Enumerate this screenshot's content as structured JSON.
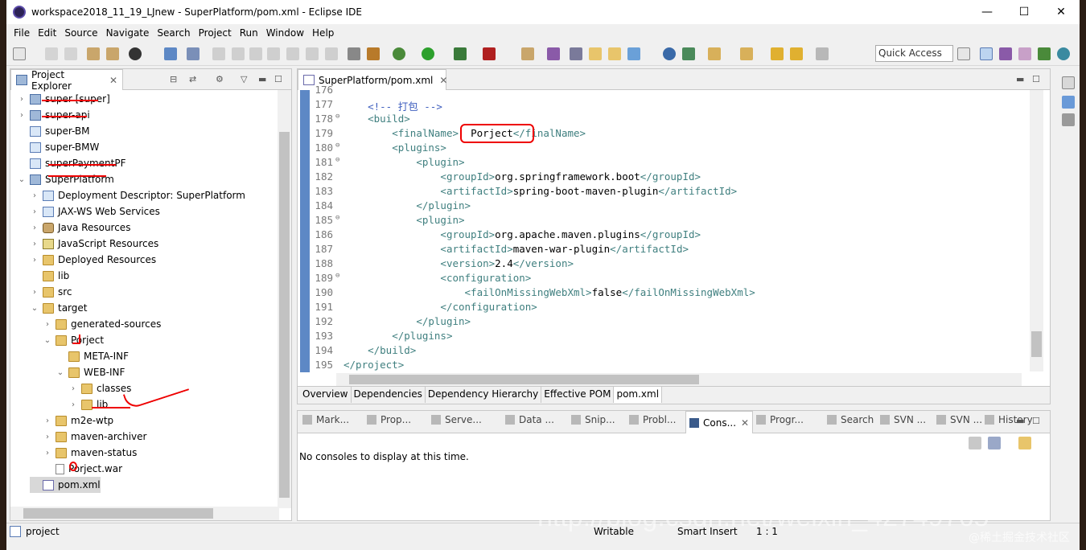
{
  "window": {
    "title": "workspace2018_11_19_LJnew - SuperPlatform/pom.xml - Eclipse IDE",
    "minimize": "—",
    "maximize": "☐",
    "close": "✕"
  },
  "menu": [
    "File",
    "Edit",
    "Source",
    "Navigate",
    "Search",
    "Project",
    "Run",
    "Window",
    "Help"
  ],
  "toolbar": {
    "quick_access": "Quick Access"
  },
  "project_explorer": {
    "title": "Project Explorer",
    "tree": [
      {
        "label": "super [super]",
        "level": 0,
        "twisty": "›",
        "icon": "proj"
      },
      {
        "label": "super-api",
        "level": 0,
        "twisty": "›",
        "icon": "proj"
      },
      {
        "label": "super-BM",
        "level": 0,
        "twisty": "",
        "icon": "folder-blue"
      },
      {
        "label": "super-BMW",
        "level": 0,
        "twisty": "",
        "icon": "folder-blue"
      },
      {
        "label": "superPaymentPF",
        "level": 0,
        "twisty": "",
        "icon": "folder-blue"
      },
      {
        "label": "SuperPlatform",
        "level": 0,
        "twisty": "⌄",
        "icon": "proj"
      },
      {
        "label": "Deployment Descriptor: SuperPlatform",
        "level": 1,
        "twisty": "›",
        "icon": "web"
      },
      {
        "label": "JAX-WS Web Services",
        "level": 1,
        "twisty": "›",
        "icon": "web"
      },
      {
        "label": "Java Resources",
        "level": 1,
        "twisty": "›",
        "icon": "gear"
      },
      {
        "label": "JavaScript Resources",
        "level": 1,
        "twisty": "›",
        "icon": "js"
      },
      {
        "label": "Deployed Resources",
        "level": 1,
        "twisty": "›",
        "icon": "folder"
      },
      {
        "label": "lib",
        "level": 1,
        "twisty": "",
        "icon": "folder"
      },
      {
        "label": "src",
        "level": 1,
        "twisty": "›",
        "icon": "folder"
      },
      {
        "label": "target",
        "level": 1,
        "twisty": "⌄",
        "icon": "folder"
      },
      {
        "label": "generated-sources",
        "level": 2,
        "twisty": "›",
        "icon": "folder"
      },
      {
        "label": "Porject",
        "level": 2,
        "twisty": "⌄",
        "icon": "folder"
      },
      {
        "label": "META-INF",
        "level": 3,
        "twisty": "",
        "icon": "folder"
      },
      {
        "label": "WEB-INF",
        "level": 3,
        "twisty": "⌄",
        "icon": "folder"
      },
      {
        "label": "classes",
        "level": 4,
        "twisty": "›",
        "icon": "folder"
      },
      {
        "label": "lib",
        "level": 4,
        "twisty": "›",
        "icon": "folder"
      },
      {
        "label": "m2e-wtp",
        "level": 2,
        "twisty": "›",
        "icon": "folder"
      },
      {
        "label": "maven-archiver",
        "level": 2,
        "twisty": "›",
        "icon": "folder"
      },
      {
        "label": "maven-status",
        "level": 2,
        "twisty": "›",
        "icon": "folder"
      },
      {
        "label": "Porject.war",
        "level": 2,
        "twisty": "",
        "icon": "file"
      },
      {
        "label": "pom.xml",
        "level": 1,
        "twisty": "",
        "icon": "pom"
      }
    ]
  },
  "editor": {
    "tab": "SuperPlatform/pom.xml",
    "lines": [
      {
        "n": "176",
        "fold": "",
        "indent": 1,
        "parts": [
          {
            "t": "",
            "c": "txt"
          }
        ]
      },
      {
        "n": "177",
        "fold": "",
        "indent": 1,
        "parts": [
          {
            "t": "<!-- 打包 -->",
            "c": "cmt"
          }
        ]
      },
      {
        "n": "178",
        "fold": "⊖",
        "indent": 1,
        "parts": [
          {
            "t": "<build>",
            "c": "tag"
          }
        ]
      },
      {
        "n": "179",
        "fold": "",
        "indent": 2,
        "parts": [
          {
            "t": "<finalName>",
            "c": "tag"
          },
          {
            "t": "  Porject",
            "c": "txt"
          },
          {
            "t": "</finalName>",
            "c": "tag"
          }
        ]
      },
      {
        "n": "180",
        "fold": "⊖",
        "indent": 2,
        "parts": [
          {
            "t": "<plugins>",
            "c": "tag"
          }
        ]
      },
      {
        "n": "181",
        "fold": "⊖",
        "indent": 3,
        "parts": [
          {
            "t": "<plugin>",
            "c": "tag"
          }
        ]
      },
      {
        "n": "182",
        "fold": "",
        "indent": 4,
        "parts": [
          {
            "t": "<groupId>",
            "c": "tag"
          },
          {
            "t": "org.springframework.boot",
            "c": "txt"
          },
          {
            "t": "</groupId>",
            "c": "tag"
          }
        ]
      },
      {
        "n": "183",
        "fold": "",
        "indent": 4,
        "parts": [
          {
            "t": "<artifactId>",
            "c": "tag"
          },
          {
            "t": "spring-boot-maven-plugin",
            "c": "txt"
          },
          {
            "t": "</artifactId>",
            "c": "tag"
          }
        ]
      },
      {
        "n": "184",
        "fold": "",
        "indent": 3,
        "parts": [
          {
            "t": "</plugin>",
            "c": "tag"
          }
        ]
      },
      {
        "n": "185",
        "fold": "⊖",
        "indent": 3,
        "parts": [
          {
            "t": "<plugin>",
            "c": "tag"
          }
        ]
      },
      {
        "n": "186",
        "fold": "",
        "indent": 4,
        "parts": [
          {
            "t": "<groupId>",
            "c": "tag"
          },
          {
            "t": "org.apache.maven.plugins",
            "c": "txt"
          },
          {
            "t": "</groupId>",
            "c": "tag"
          }
        ]
      },
      {
        "n": "187",
        "fold": "",
        "indent": 4,
        "parts": [
          {
            "t": "<artifactId>",
            "c": "tag"
          },
          {
            "t": "maven-war-plugin",
            "c": "txt"
          },
          {
            "t": "</artifactId>",
            "c": "tag"
          }
        ]
      },
      {
        "n": "188",
        "fold": "",
        "indent": 4,
        "parts": [
          {
            "t": "<version>",
            "c": "tag"
          },
          {
            "t": "2.4",
            "c": "txt"
          },
          {
            "t": "</version>",
            "c": "tag"
          }
        ]
      },
      {
        "n": "189",
        "fold": "⊖",
        "indent": 4,
        "parts": [
          {
            "t": "<configuration>",
            "c": "tag"
          }
        ]
      },
      {
        "n": "190",
        "fold": "",
        "indent": 5,
        "parts": [
          {
            "t": "<failOnMissingWebXml>",
            "c": "tag"
          },
          {
            "t": "false",
            "c": "txt"
          },
          {
            "t": "</failOnMissingWebXml>",
            "c": "tag"
          }
        ]
      },
      {
        "n": "191",
        "fold": "",
        "indent": 4,
        "parts": [
          {
            "t": "</configuration>",
            "c": "tag"
          }
        ]
      },
      {
        "n": "192",
        "fold": "",
        "indent": 3,
        "parts": [
          {
            "t": "</plugin>",
            "c": "tag"
          }
        ]
      },
      {
        "n": "193",
        "fold": "",
        "indent": 2,
        "parts": [
          {
            "t": "</plugins>",
            "c": "tag"
          }
        ]
      },
      {
        "n": "194",
        "fold": "",
        "indent": 1,
        "parts": [
          {
            "t": "</build>",
            "c": "tag"
          }
        ]
      },
      {
        "n": "195",
        "fold": "",
        "indent": 0,
        "parts": [
          {
            "t": "</project>",
            "c": "tag"
          }
        ]
      }
    ],
    "bottom_tabs": [
      "Overview",
      "Dependencies",
      "Dependency Hierarchy",
      "Effective POM",
      "pom.xml"
    ],
    "active_bottom_tab": "pom.xml"
  },
  "console_views": {
    "tabs": [
      "Mark...",
      "Prop...",
      "Serve...",
      "Data ...",
      "Snip...",
      "Probl...",
      "Cons...",
      "Progr...",
      "Search",
      "SVN ...",
      "SVN ...",
      "History"
    ],
    "active": "Cons...",
    "message": "No consoles to display at this time."
  },
  "status": {
    "project": "project",
    "writable": "Writable",
    "insert_mode": "Smart Insert",
    "position": "1 : 1",
    "watermark": "http://blog.csdn.net/weixin_42749765",
    "watermark2": "@稀土掘金技术社区"
  }
}
